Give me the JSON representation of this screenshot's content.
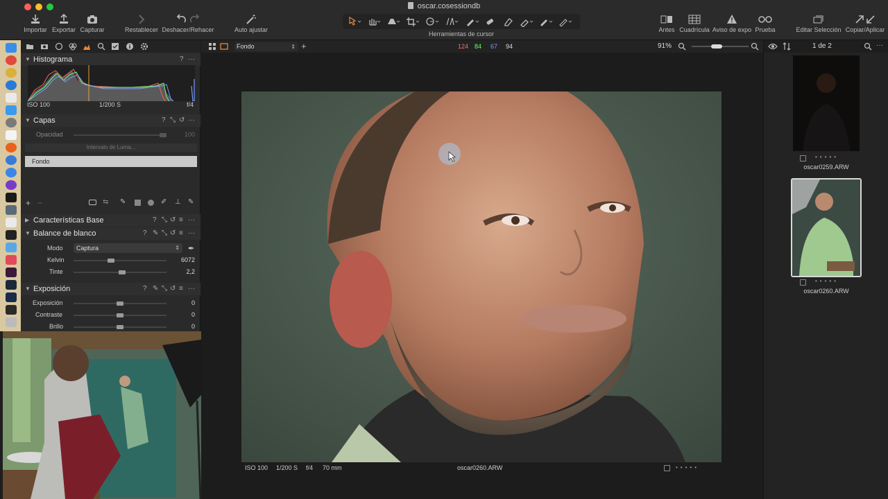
{
  "window": {
    "title": "oscar.cosessiondb"
  },
  "colors": {
    "accent": "#e8873a",
    "bg": "#1e1e1e",
    "panel": "#2a2a2a",
    "hist_red": "#ff6060",
    "hist_green": "#6aff6a",
    "hist_blue": "#7a9cff"
  },
  "toolbar": {
    "import": "Importar",
    "export": "Exportar",
    "capture": "Capturar",
    "reset": "Restablecer",
    "undo_redo": "Deshacer/Rehacer",
    "auto_adjust": "Auto ajustar",
    "cursor_tools": "Herramientas de cursor",
    "before": "Antes",
    "grid": "Cuadrícula",
    "exposure_warning": "Aviso de expo",
    "proof": "Prueba",
    "edit_selection": "Editar Selección",
    "copy_apply": "Copiar/Aplicar"
  },
  "viewer_bar": {
    "style_select": "Fondo",
    "rgb": {
      "r": "124",
      "g": "84",
      "b": "67",
      "l": "94"
    },
    "zoom": "91%"
  },
  "histogram": {
    "title": "Histograma",
    "iso": "ISO 100",
    "shutter": "1/200 S",
    "aperture": "f/4"
  },
  "layers": {
    "title": "Capas",
    "opacity_label": "Opacidad",
    "opacity_value": "100",
    "luma_button": "Intervalo de Luma...",
    "layer_name": "Fondo"
  },
  "base_characteristics": {
    "title": "Características Base"
  },
  "white_balance": {
    "title": "Balance de blanco",
    "mode_label": "Modo",
    "mode_value": "Captura",
    "kelvin_label": "Kelvin",
    "kelvin_value": "6072",
    "tint_label": "Tinte",
    "tint_value": "2,2"
  },
  "exposure": {
    "title": "Exposición",
    "exposure_label": "Exposición",
    "exposure_value": "0",
    "contrast_label": "Contraste",
    "contrast_value": "0",
    "brightness_label": "Brillo",
    "brightness_value": "0"
  },
  "viewer_footer": {
    "iso": "ISO 100",
    "shutter": "1/200 S",
    "aperture": "f/4",
    "focal": "70 mm",
    "filename": "oscar0260.ARW"
  },
  "browser": {
    "count": "1 de 2",
    "items": [
      {
        "name": "oscar0259.ARW"
      },
      {
        "name": "oscar0260.ARW"
      }
    ]
  }
}
